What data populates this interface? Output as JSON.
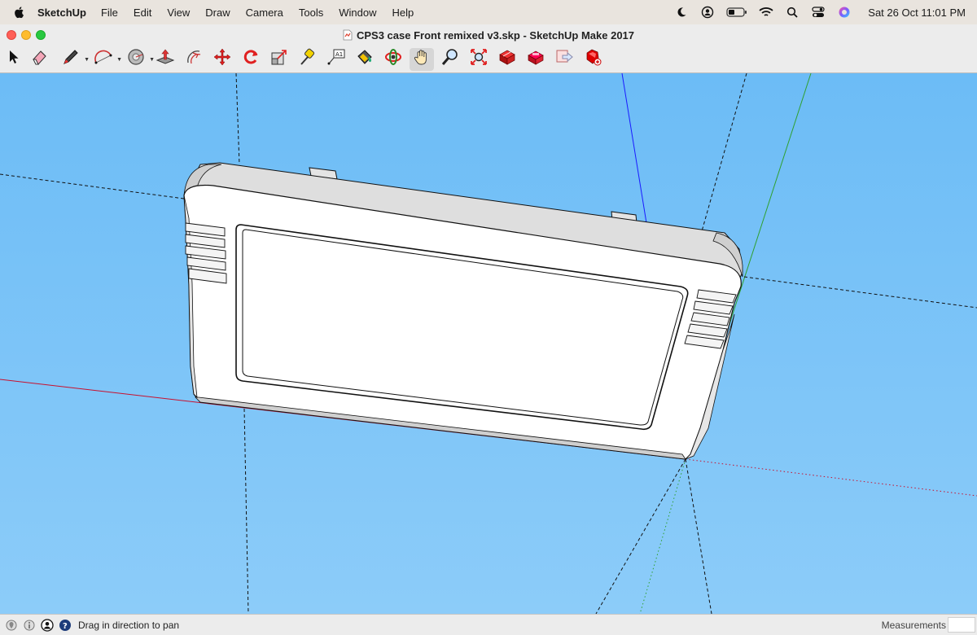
{
  "menubar": {
    "apple_icon": "apple-icon",
    "app_name": "SketchUp",
    "items": [
      "File",
      "Edit",
      "View",
      "Draw",
      "Camera",
      "Tools",
      "Window",
      "Help"
    ],
    "status_icons": [
      "moon-icon",
      "user-circle-icon",
      "battery-icon",
      "wifi-icon",
      "search-icon",
      "control-center-icon",
      "siri-icon"
    ],
    "clock": "Sat 26 Oct  11:01 PM"
  },
  "window": {
    "title": "CPS3 case Front remixed v3.skp - SketchUp Make 2017"
  },
  "toolbar": {
    "tools": [
      {
        "name": "select-tool",
        "icon": "arrow-cursor-icon"
      },
      {
        "name": "eraser-tool",
        "icon": "eraser-icon"
      },
      {
        "name": "line-tool",
        "icon": "pencil-icon"
      },
      {
        "name": "arc-tool",
        "icon": "arc-icon"
      },
      {
        "name": "shapes-tool",
        "icon": "circle-shape-icon"
      },
      {
        "name": "push-pull-tool",
        "icon": "push-pull-icon"
      },
      {
        "name": "offset-tool",
        "icon": "offset-icon"
      },
      {
        "name": "move-tool",
        "icon": "move-arrows-icon"
      },
      {
        "name": "rotate-tool",
        "icon": "rotate-icon"
      },
      {
        "name": "scale-tool",
        "icon": "scale-icon"
      },
      {
        "name": "tape-measure-tool",
        "icon": "tape-measure-icon"
      },
      {
        "name": "text-tool",
        "icon": "text-label-icon"
      },
      {
        "name": "paint-bucket-tool",
        "icon": "paint-bucket-icon"
      },
      {
        "name": "orbit-tool",
        "icon": "orbit-icon"
      },
      {
        "name": "pan-tool",
        "icon": "hand-icon"
      },
      {
        "name": "zoom-tool",
        "icon": "magnifier-icon"
      },
      {
        "name": "zoom-extents-tool",
        "icon": "zoom-extents-icon"
      },
      {
        "name": "3d-warehouse-tool",
        "icon": "warehouse-icon"
      },
      {
        "name": "extension-warehouse-tool",
        "icon": "extension-icon"
      },
      {
        "name": "share-model-tool",
        "icon": "share-model-icon"
      },
      {
        "name": "extension-manager-tool",
        "icon": "ruby-gem-icon"
      }
    ],
    "active_tool": "pan-tool"
  },
  "statusbar": {
    "icons": [
      "geo-location-icon",
      "credits-icon",
      "user-account-icon",
      "help-icon"
    ],
    "text": "Drag in direction to pan",
    "measurements_label": "Measurements",
    "measurements_value": ""
  },
  "colors": {
    "sky_top": "#6cbcf6",
    "sky_bottom": "#8cccf9",
    "axis_red": "#c8102e",
    "axis_green": "#2fa02f",
    "axis_blue": "#1a1aff",
    "model_fill": "#ffffff"
  }
}
